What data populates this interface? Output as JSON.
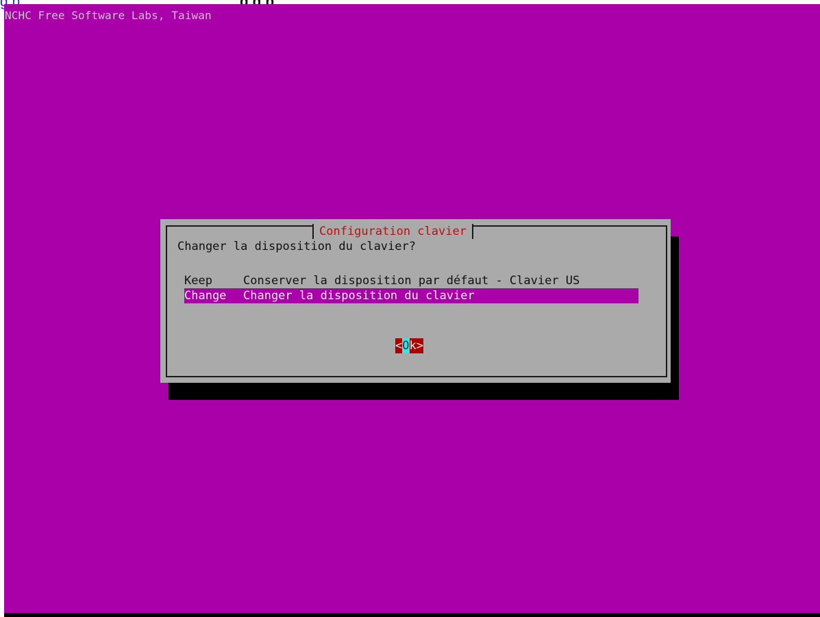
{
  "header": {
    "link_text": "g    p",
    "title_text": "g    g     p"
  },
  "terminal": {
    "top_line": "NCHC Free Software Labs, Taiwan",
    "background_color": "#aa00aa",
    "dialog_color": "#aaaaaa"
  },
  "dialog": {
    "title": "Configuration clavier",
    "question": "Changer la disposition du clavier?",
    "items": [
      {
        "key": "Keep",
        "description": "Conserver la disposition par défaut - Clavier US",
        "selected": false
      },
      {
        "key": "Change",
        "description": "Changer la disposition du clavier",
        "selected": true
      }
    ],
    "ok_button": {
      "left_bracket": "<",
      "cursor_char": "O",
      "rest": "k>",
      "highlight_color": "#aa0000",
      "cursor_color": "#38e4e4"
    }
  }
}
